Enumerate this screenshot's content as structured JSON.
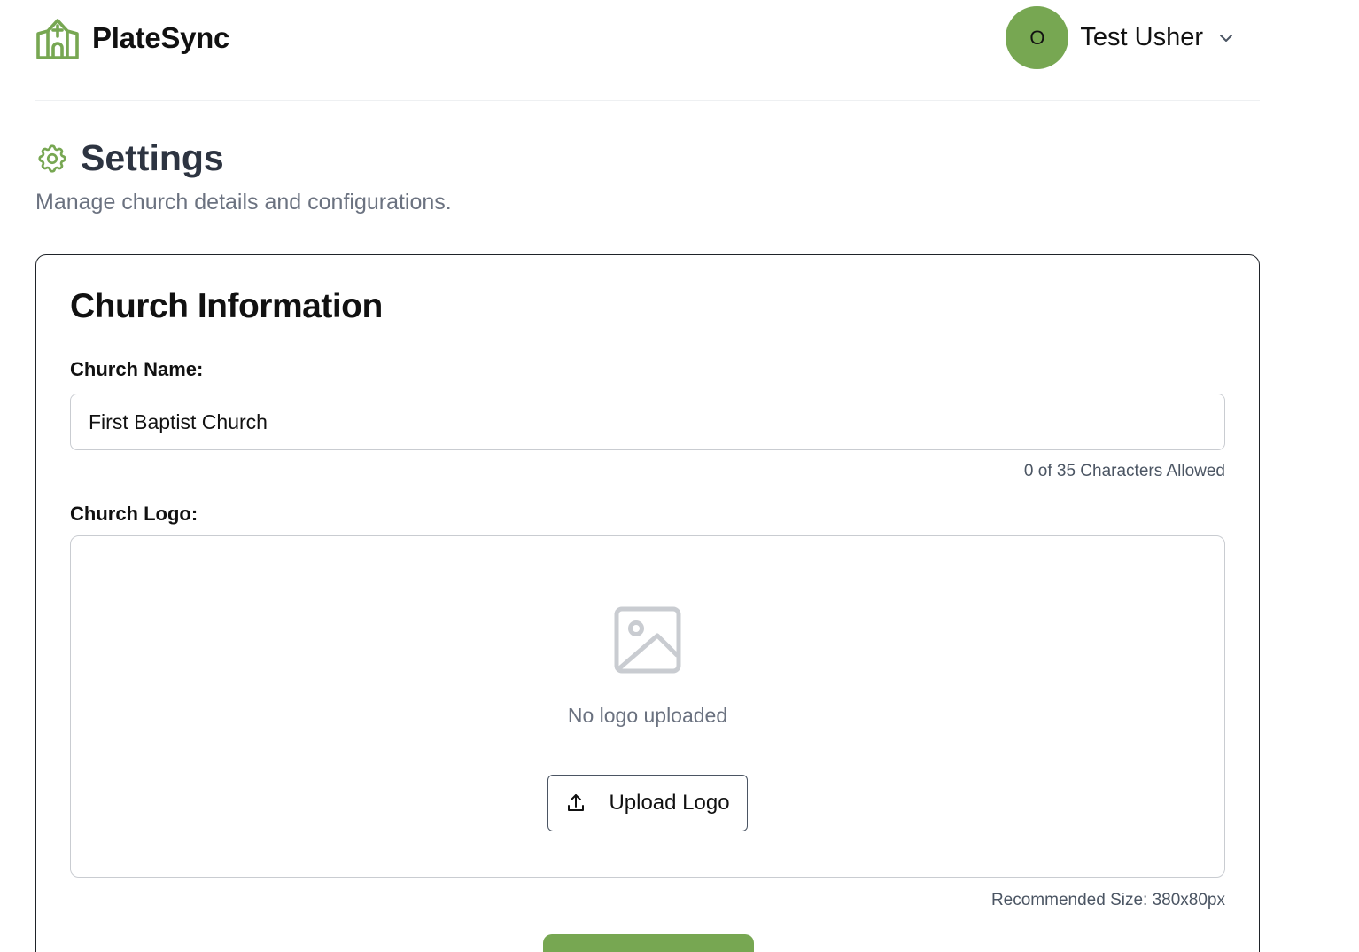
{
  "app": {
    "name": "PlateSync"
  },
  "user": {
    "initial": "O",
    "name": "Test Usher"
  },
  "page": {
    "title": "Settings",
    "subtitle": "Manage church details and configurations."
  },
  "church_info": {
    "title": "Church Information",
    "name_label": "Church Name:",
    "name_value": "First Baptist Church",
    "char_count": "0 of 35 Characters Allowed",
    "logo_label": "Church Logo:",
    "no_logo_text": "No logo uploaded",
    "upload_label": "Upload Logo",
    "recommended_size": "Recommended Size: 380x80px"
  },
  "colors": {
    "brand_green": "#77a752",
    "heading_dark": "#2d3441",
    "muted_gray": "#6b7280"
  },
  "icons": {
    "brand": "church-icon",
    "user_menu": "chevron-down-icon",
    "settings": "gear-icon",
    "logo_placeholder": "image-icon",
    "upload": "upload-icon"
  }
}
